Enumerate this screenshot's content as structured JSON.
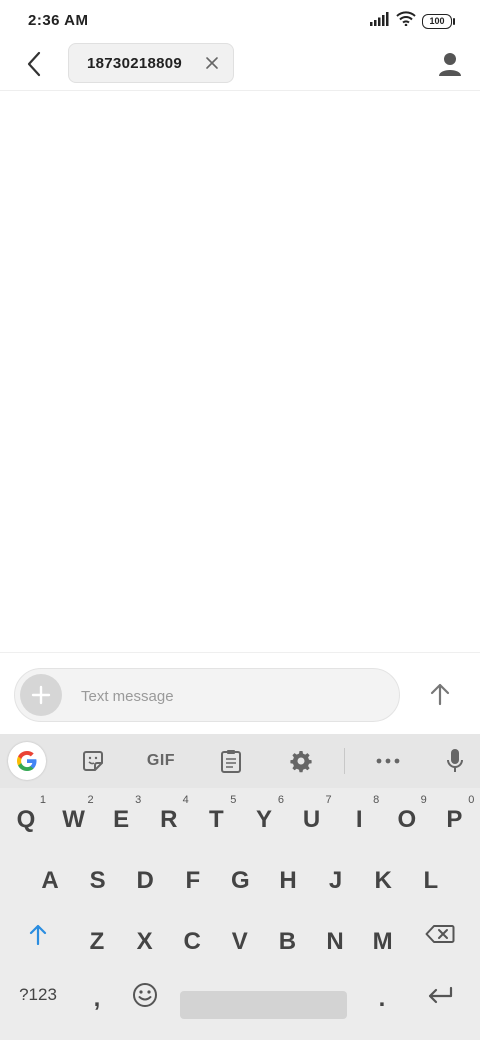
{
  "status": {
    "time": "2:36  AM",
    "battery": "100"
  },
  "header": {
    "recipient": "18730218809"
  },
  "composer": {
    "placeholder": "Text message"
  },
  "keyboard": {
    "toolbar": {
      "gif_label": "GIF"
    },
    "row1": [
      {
        "key": "Q",
        "hint": "1"
      },
      {
        "key": "W",
        "hint": "2"
      },
      {
        "key": "E",
        "hint": "3"
      },
      {
        "key": "R",
        "hint": "4"
      },
      {
        "key": "T",
        "hint": "5"
      },
      {
        "key": "Y",
        "hint": "6"
      },
      {
        "key": "U",
        "hint": "7"
      },
      {
        "key": "I",
        "hint": "8"
      },
      {
        "key": "O",
        "hint": "9"
      },
      {
        "key": "P",
        "hint": "0"
      }
    ],
    "row2": [
      "A",
      "S",
      "D",
      "F",
      "G",
      "H",
      "J",
      "K",
      "L"
    ],
    "row3": [
      "Z",
      "X",
      "C",
      "V",
      "B",
      "N",
      "M"
    ],
    "row4": {
      "symbols_label": "?123",
      "comma": ",",
      "period": "."
    }
  }
}
